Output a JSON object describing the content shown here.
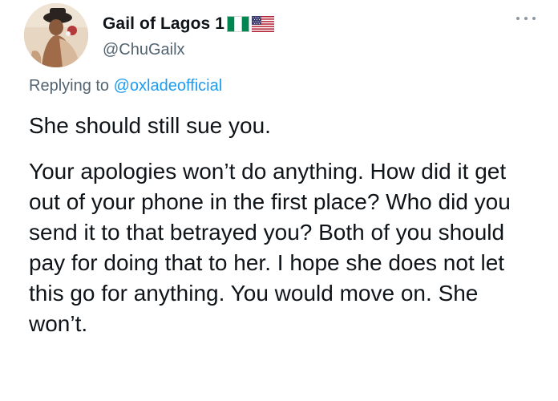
{
  "author": {
    "display_name": "Gail of Lagos 1",
    "flags": [
      "nigeria-flag",
      "us-flag"
    ],
    "handle": "@ChuGailx",
    "avatar": "profile-photo"
  },
  "reply": {
    "prefix": "Replying to ",
    "mention": "@oxladeofficial"
  },
  "tweet": {
    "paragraphs": [
      "She should still sue you.",
      "Your apologies won’t do anything. How did it get out of your phone in the first place? Who did you send it to that betrayed you? Both of you should pay for doing that to her. I hope she does not let this go for anything. You would move on. She won’t."
    ]
  },
  "colors": {
    "text": "#0f1419",
    "secondary": "#536471",
    "link": "#1d9bf0",
    "more_dots": "#8b98a5"
  },
  "icons": {
    "more": "more-options-icon"
  }
}
